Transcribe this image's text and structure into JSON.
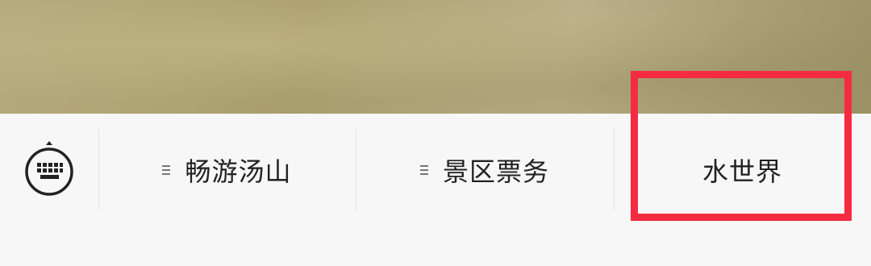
{
  "menu": {
    "keyboard_icon": "keyboard-icon",
    "items": [
      {
        "label": "畅游汤山",
        "has_submenu": true
      },
      {
        "label": "景区票务",
        "has_submenu": true
      },
      {
        "label": "水世界",
        "has_submenu": false
      }
    ]
  },
  "colors": {
    "highlight": "#f52b42",
    "bar_background": "#f7f7f7"
  }
}
